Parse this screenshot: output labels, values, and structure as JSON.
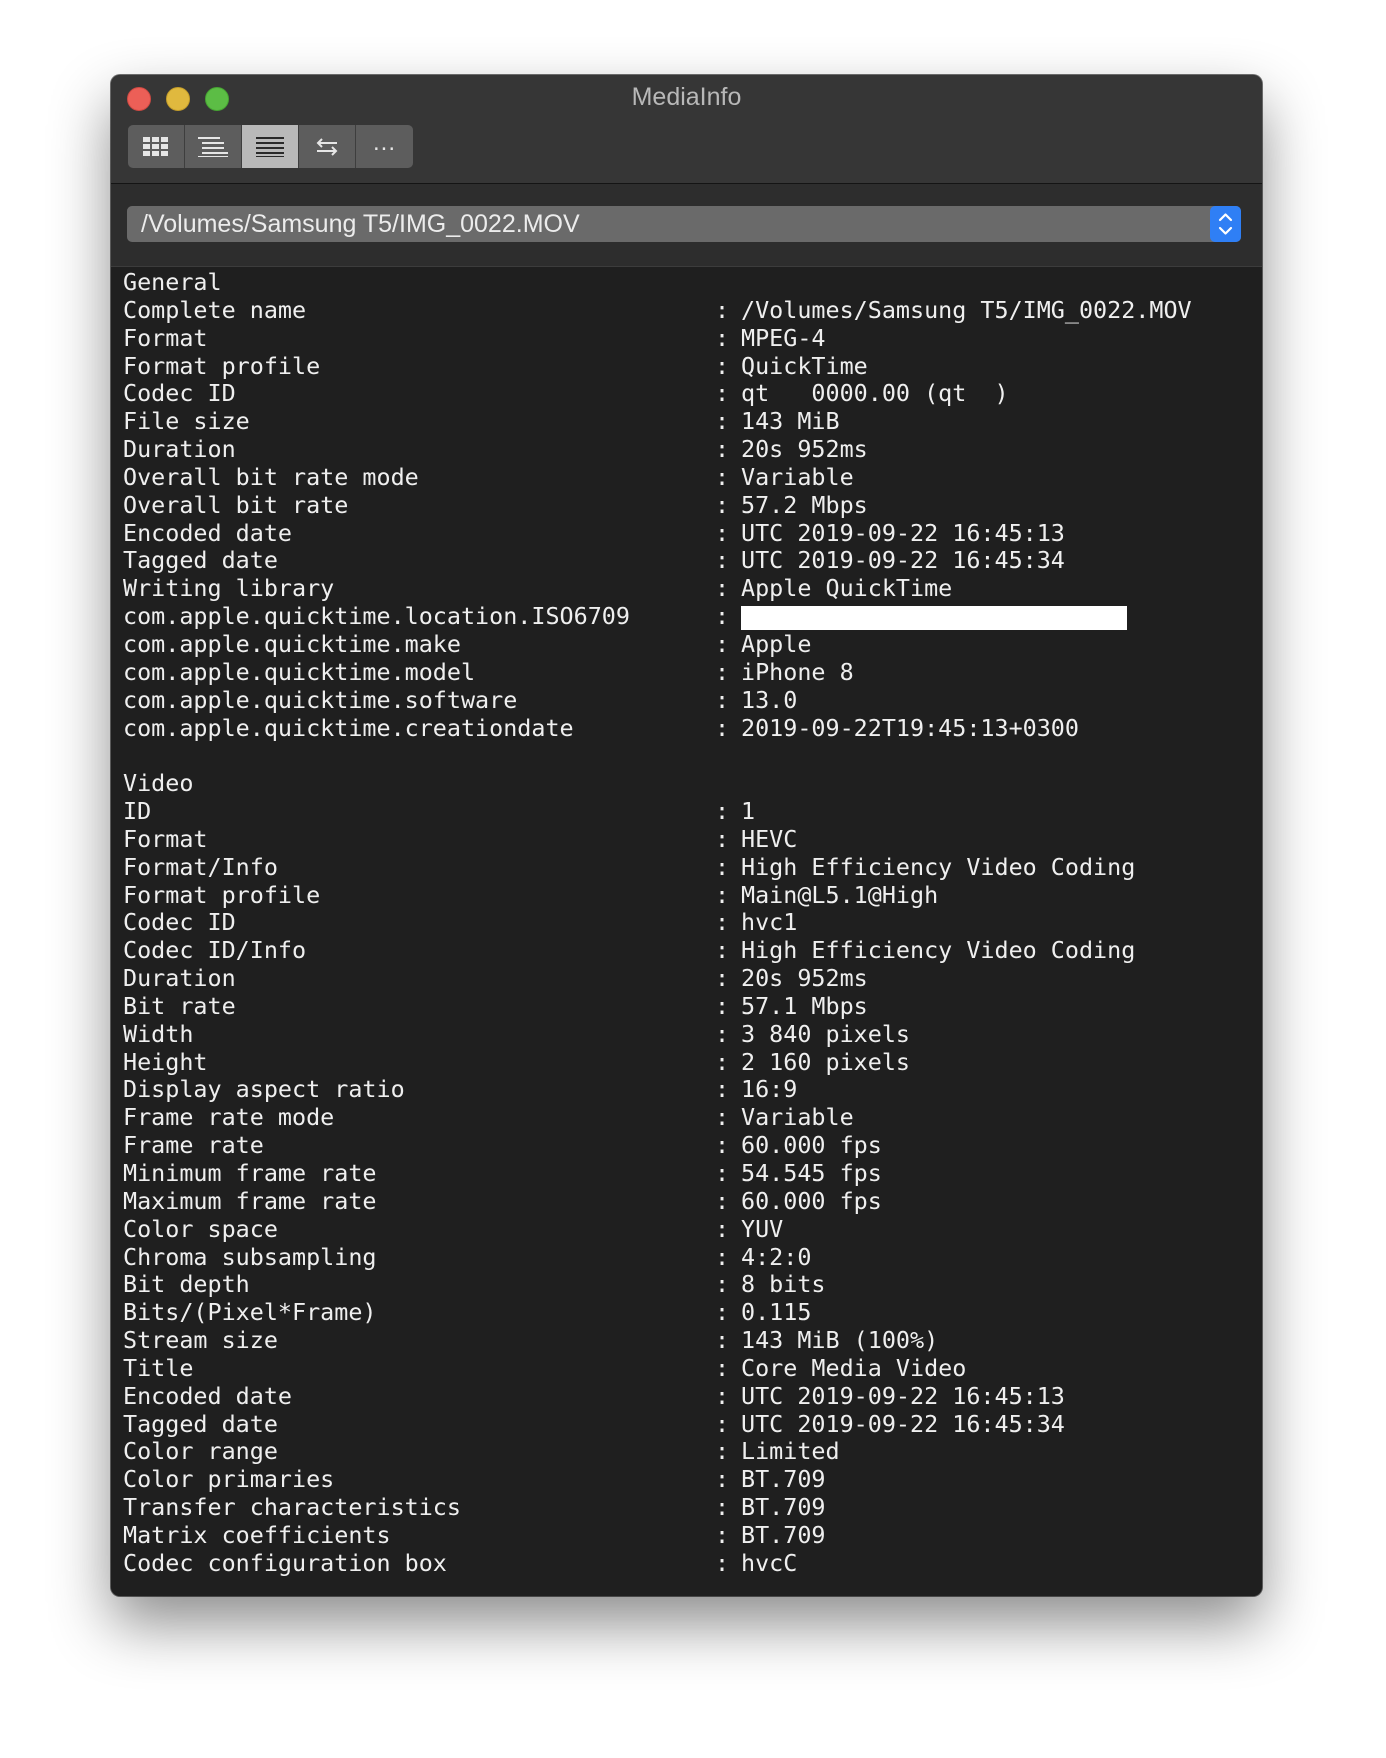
{
  "window": {
    "title": "MediaInfo"
  },
  "toolbar": {
    "buttons": [
      {
        "icon": "grid-view-icon"
      },
      {
        "icon": "tree-view-icon"
      },
      {
        "icon": "text-view-icon",
        "active": true
      },
      {
        "icon": "swap-arrows-icon"
      },
      {
        "label": "..."
      }
    ]
  },
  "file_selector": {
    "value": "/Volumes/Samsung T5/IMG_0022.MOV"
  },
  "separator": ":",
  "general": {
    "header": "General",
    "fields": [
      {
        "key": "Complete name",
        "value": "/Volumes/Samsung T5/IMG_0022.MOV"
      },
      {
        "key": "Format",
        "value": "MPEG-4"
      },
      {
        "key": "Format profile",
        "value": "QuickTime"
      },
      {
        "key": "Codec ID",
        "value": "qt   0000.00 (qt  )"
      },
      {
        "key": "File size",
        "value": "143 MiB"
      },
      {
        "key": "Duration",
        "value": "20s 952ms"
      },
      {
        "key": "Overall bit rate mode",
        "value": "Variable"
      },
      {
        "key": "Overall bit rate",
        "value": "57.2 Mbps"
      },
      {
        "key": "Encoded date",
        "value": "UTC 2019-09-22 16:45:13"
      },
      {
        "key": "Tagged date",
        "value": "UTC 2019-09-22 16:45:34"
      },
      {
        "key": "Writing library",
        "value": "Apple QuickTime"
      },
      {
        "key": "com.apple.quicktime.location.ISO6709",
        "value": ""
      },
      {
        "key": "com.apple.quicktime.make",
        "value": "Apple"
      },
      {
        "key": "com.apple.quicktime.model",
        "value": "iPhone 8"
      },
      {
        "key": "com.apple.quicktime.software",
        "value": "13.0"
      },
      {
        "key": "com.apple.quicktime.creationdate",
        "value": "2019-09-22T19:45:13+0300"
      }
    ]
  },
  "video": {
    "header": "Video",
    "fields": [
      {
        "key": "ID",
        "value": "1"
      },
      {
        "key": "Format",
        "value": "HEVC"
      },
      {
        "key": "Format/Info",
        "value": "High Efficiency Video Coding"
      },
      {
        "key": "Format profile",
        "value": "Main@L5.1@High"
      },
      {
        "key": "Codec ID",
        "value": "hvc1"
      },
      {
        "key": "Codec ID/Info",
        "value": "High Efficiency Video Coding"
      },
      {
        "key": "Duration",
        "value": "20s 952ms"
      },
      {
        "key": "Bit rate",
        "value": "57.1 Mbps"
      },
      {
        "key": "Width",
        "value": "3 840 pixels"
      },
      {
        "key": "Height",
        "value": "2 160 pixels"
      },
      {
        "key": "Display aspect ratio",
        "value": "16:9"
      },
      {
        "key": "Frame rate mode",
        "value": "Variable"
      },
      {
        "key": "Frame rate",
        "value": "60.000 fps"
      },
      {
        "key": "Minimum frame rate",
        "value": "54.545 fps"
      },
      {
        "key": "Maximum frame rate",
        "value": "60.000 fps"
      },
      {
        "key": "Color space",
        "value": "YUV"
      },
      {
        "key": "Chroma subsampling",
        "value": "4:2:0"
      },
      {
        "key": "Bit depth",
        "value": "8 bits"
      },
      {
        "key": "Bits/(Pixel*Frame)",
        "value": "0.115"
      },
      {
        "key": "Stream size",
        "value": "143 MiB (100%)"
      },
      {
        "key": "Title",
        "value": "Core Media Video"
      },
      {
        "key": "Encoded date",
        "value": "UTC 2019-09-22 16:45:13"
      },
      {
        "key": "Tagged date",
        "value": "UTC 2019-09-22 16:45:34"
      },
      {
        "key": "Color range",
        "value": "Limited"
      },
      {
        "key": "Color primaries",
        "value": "BT.709"
      },
      {
        "key": "Transfer characteristics",
        "value": "BT.709"
      },
      {
        "key": "Matrix coefficients",
        "value": "BT.709"
      },
      {
        "key": "Codec configuration box",
        "value": "hvcC"
      }
    ]
  }
}
